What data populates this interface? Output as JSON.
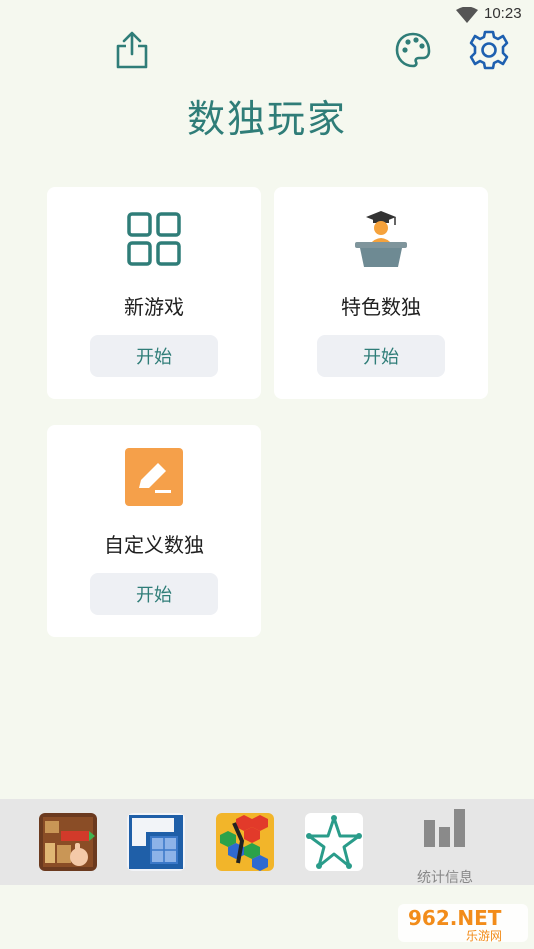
{
  "status_bar": {
    "time": "10:23",
    "wifi_icon": "wifi-icon"
  },
  "header": {
    "title": "数独玩家",
    "share_icon": "share-icon",
    "palette_icon": "palette-icon",
    "settings_icon": "gear-icon"
  },
  "cards": [
    {
      "label": "新游戏",
      "button": "开始",
      "icon": "grid-icon",
      "icon_color": "#2f7d78"
    },
    {
      "label": "特色数独",
      "button": "开始",
      "icon": "teacher-podium-icon",
      "icon_color": "#6e8a93"
    },
    {
      "label": "自定义数独",
      "button": "开始",
      "icon": "edit-pencil-icon",
      "icon_color": "#f5a04a"
    }
  ],
  "bottom_bar": {
    "games": [
      {
        "icon": "unblock-puzzle-game-icon"
      },
      {
        "icon": "block-fit-game-icon"
      },
      {
        "icon": "hexa-puzzle-game-icon"
      },
      {
        "icon": "one-line-star-game-icon"
      }
    ],
    "stats_label": "统计信息",
    "stats_icon": "bar-chart-icon"
  },
  "watermark": {
    "main": "962.NET",
    "sub": "乐游网"
  },
  "colors": {
    "accent": "#2f7d78",
    "background": "#f5f8ef",
    "button_bg": "#eef0f4",
    "bottom_bar": "#e6e6e6"
  }
}
